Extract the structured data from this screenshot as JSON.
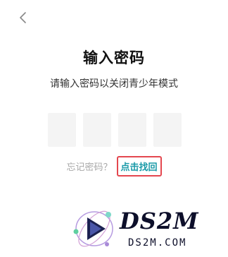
{
  "header": {
    "back_icon": "chevron-left-icon"
  },
  "main": {
    "title": "输入密码",
    "subtitle": "请输入密码以关闭青少年模式",
    "code_box_count": 4
  },
  "forgot": {
    "label": "忘记密码？",
    "link": "点击找回",
    "link_color": "#1a9aa8",
    "highlight_color": "#e4474f"
  },
  "watermark": {
    "brand": "DS2M",
    "domain": "DS2M.COM"
  }
}
